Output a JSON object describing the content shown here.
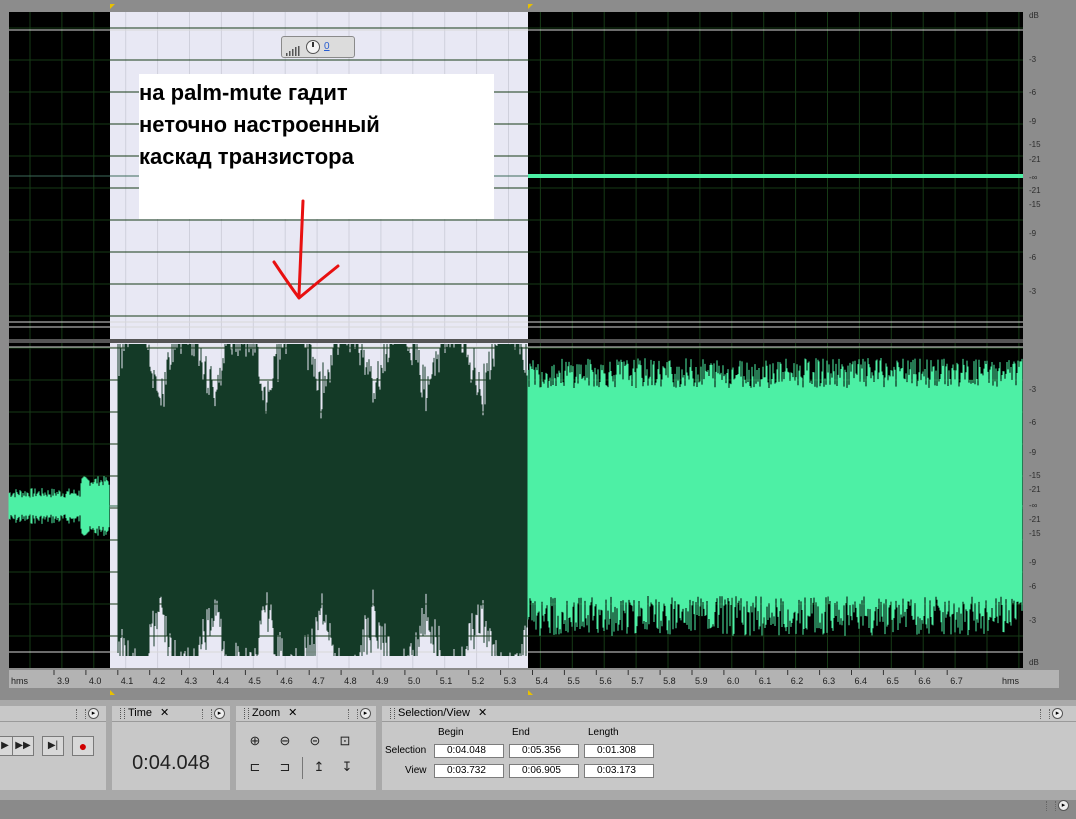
{
  "editor": {
    "db_scale_top": [
      "dB",
      "-3",
      "-6",
      "-9",
      "-15",
      "-21",
      "-∞",
      "-21",
      "-15",
      "-9",
      "-6",
      "-3"
    ],
    "db_scale_bottom": [
      "-3",
      "-6",
      "-9",
      "-15",
      "-21",
      "-∞",
      "-21",
      "-15",
      "-9",
      "-6",
      "-3",
      "dB"
    ],
    "time_ruler": {
      "left_label": "hms",
      "right_label": "hms",
      "ticks": [
        "3.9",
        "4.0",
        "4.1",
        "4.2",
        "4.3",
        "4.4",
        "4.5",
        "4.6",
        "4.7",
        "4.8",
        "4.9",
        "5.0",
        "5.1",
        "5.2",
        "5.3",
        "5.4",
        "5.5",
        "5.6",
        "5.7",
        "5.8",
        "5.9",
        "6.0",
        "6.1",
        "6.2",
        "6.3",
        "6.4",
        "6.5",
        "6.6",
        "6.7"
      ]
    },
    "volume_knob_value": "0",
    "annotation_text": "на palm-mute гадит\nнеточно настроенный\nкаскад транзистора",
    "colors": {
      "waveform": "#4df0a5",
      "waveform_selected": "#143a27",
      "selection": "#e8e8f4",
      "background": "#000000",
      "annotation_arrow": "#e81010"
    }
  },
  "panels": {
    "time": {
      "title": "Time",
      "value": "0:04.048"
    },
    "zoom": {
      "title": "Zoom"
    },
    "selection_view": {
      "title": "Selection/View",
      "headers": [
        "Begin",
        "End",
        "Length"
      ],
      "rows": [
        {
          "label": "Selection",
          "begin": "0:04.048",
          "end": "0:05.356",
          "length": "0:01.308"
        },
        {
          "label": "View",
          "begin": "0:03.732",
          "end": "0:06.905",
          "length": "0:03.173"
        }
      ]
    }
  }
}
